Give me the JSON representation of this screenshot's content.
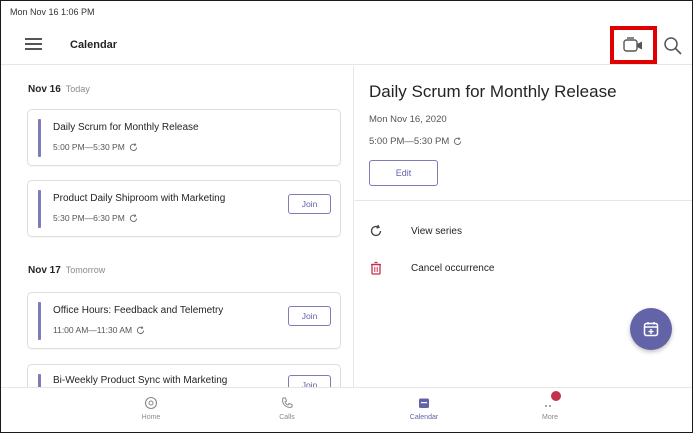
{
  "status_bar": {
    "datetime": "Mon Nov 16  1:06 PM"
  },
  "app_bar": {
    "title": "Calendar"
  },
  "agenda": {
    "days": [
      {
        "date": "Nov 16",
        "relative": "Today",
        "events": [
          {
            "title": "Daily Scrum for Monthly Release",
            "time": "5:00 PM—5:30 PM",
            "join_label": ""
          },
          {
            "title": "Product Daily Shiproom with Marketing",
            "time": "5:30 PM—6:30 PM",
            "join_label": "Join"
          }
        ]
      },
      {
        "date": "Nov 17",
        "relative": "Tomorrow",
        "events": [
          {
            "title": "Office Hours: Feedback and Telemetry",
            "time": "11:00 AM—11:30 AM",
            "join_label": "Join"
          },
          {
            "title": "Bi-Weekly Product Sync with Marketing",
            "time": "",
            "join_label": "Join"
          }
        ]
      }
    ]
  },
  "detail": {
    "title": "Daily Scrum for Monthly Release",
    "date": "Mon Nov 16, 2020",
    "time": "5:00 PM—5:30 PM",
    "edit_label": "Edit",
    "actions": [
      {
        "label": "View series",
        "icon": "recurring-icon"
      },
      {
        "label": "Cancel occurrence",
        "icon": "trash-icon"
      }
    ]
  },
  "bottom_nav": {
    "items": [
      {
        "label": "Home",
        "icon": "home-icon"
      },
      {
        "label": "Calls",
        "icon": "phone-icon"
      },
      {
        "label": "Calendar",
        "icon": "calendar-icon"
      },
      {
        "label": "More",
        "icon": "more-icon"
      }
    ]
  },
  "colors": {
    "accent": "#6264a7",
    "highlight_box": "#e00000",
    "badge": "#c4314b",
    "cancel_icon": "#c4314b"
  }
}
